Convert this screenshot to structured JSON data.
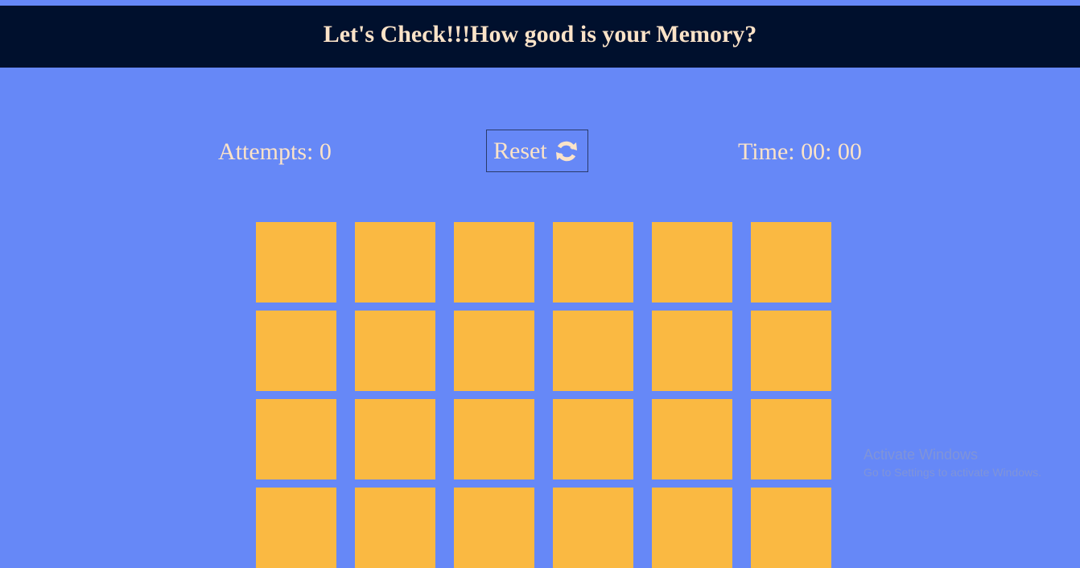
{
  "header": {
    "title": "Let's Check!!!How good is your Memory?"
  },
  "stats": {
    "attempts_label": "Attempts: 0",
    "attempts_value": 0,
    "timer_label": "Time: 00: 00",
    "timer_value": "00:00"
  },
  "reset": {
    "label": "Reset",
    "icon": "refresh-icon"
  },
  "board": {
    "columns": 6,
    "visible_rows": 4,
    "cards": [
      {
        "state": "face-down"
      },
      {
        "state": "face-down"
      },
      {
        "state": "face-down"
      },
      {
        "state": "face-down"
      },
      {
        "state": "face-down"
      },
      {
        "state": "face-down"
      },
      {
        "state": "face-down"
      },
      {
        "state": "face-down"
      },
      {
        "state": "face-down"
      },
      {
        "state": "face-down"
      },
      {
        "state": "face-down"
      },
      {
        "state": "face-down"
      },
      {
        "state": "face-down"
      },
      {
        "state": "face-down"
      },
      {
        "state": "face-down"
      },
      {
        "state": "face-down"
      },
      {
        "state": "face-down"
      },
      {
        "state": "face-down"
      },
      {
        "state": "face-down"
      },
      {
        "state": "face-down"
      },
      {
        "state": "face-down"
      },
      {
        "state": "face-down"
      },
      {
        "state": "face-down"
      },
      {
        "state": "face-down"
      }
    ],
    "card_color": "#fab942"
  },
  "watermark": {
    "title": "Activate Windows",
    "subtitle": "Go to Settings to activate Windows."
  },
  "colors": {
    "background": "#6688f7",
    "header_bg": "#00102d",
    "text": "#fbe3c8",
    "card": "#fab942"
  }
}
